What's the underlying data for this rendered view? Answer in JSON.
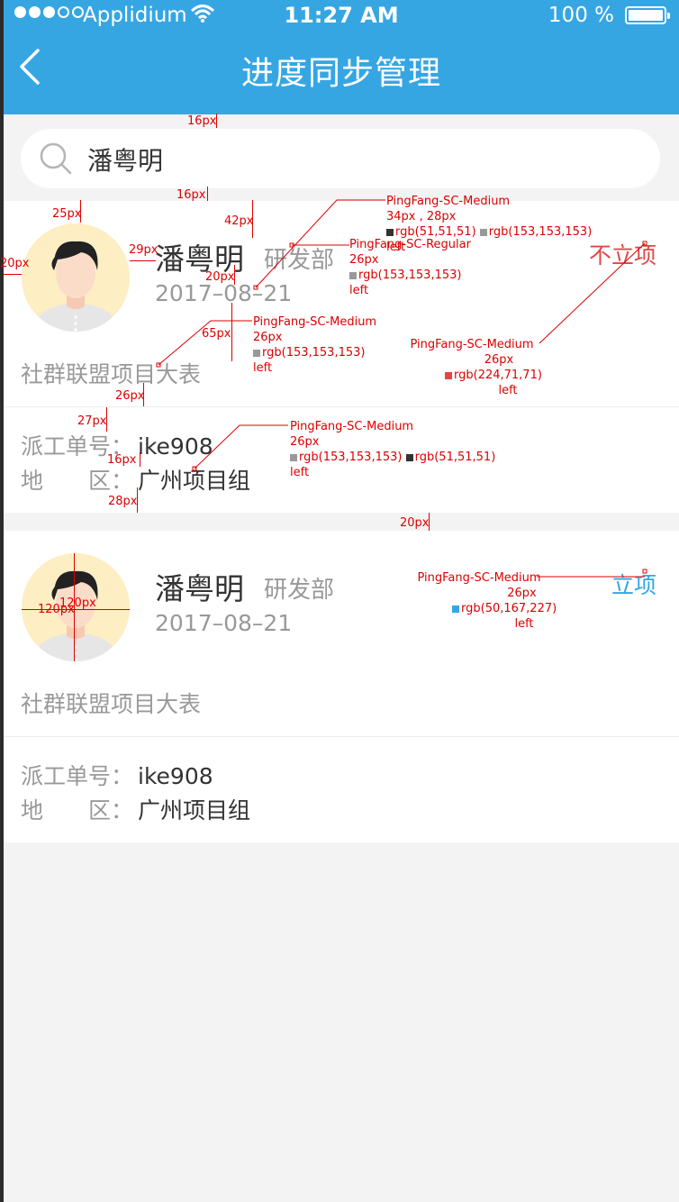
{
  "status_bar": {
    "carrier": "Applidium",
    "time": "11:27 AM",
    "battery": "100 %"
  },
  "header": {
    "title": "进度同步管理"
  },
  "search": {
    "value": "潘粤明"
  },
  "cards": [
    {
      "name": "潘粤明",
      "department": "研发部",
      "date": "2017–08–21",
      "status": "不立项",
      "status_color": "#e04747",
      "project": "社群联盟项目大表",
      "order_label": "派工单号：",
      "order_value": "ike908",
      "region_label": "地　　区：",
      "region_value": "广州项目组"
    },
    {
      "name": "潘粤明",
      "department": "研发部",
      "date": "2017–08–21",
      "status": "立项",
      "status_color": "#32a7e3",
      "project": "社群联盟项目大表",
      "order_label": "派工单号：",
      "order_value": "ike908",
      "region_label": "地　　区：",
      "region_value": "广州项目组"
    }
  ],
  "annotations": {
    "a1": "16px",
    "a2": "16px",
    "a3": "25px",
    "a4": "42px",
    "a5": "20px",
    "a6": "29px",
    "a7": "20px",
    "a8": "65px",
    "a9": "26px",
    "a10": "27px",
    "a11": "16px",
    "a12": "28px",
    "a13": "20px",
    "a14": "120px",
    "a15": "120px",
    "spec1": [
      "PingFang-SC-Medium",
      "34px , 28px",
      "rgb(51,51,51)",
      "rgb(153,153,153)",
      "left"
    ],
    "spec2": [
      "PingFang-SC-Regular",
      "26px",
      "rgb(153,153,153)",
      "left"
    ],
    "spec3": [
      "PingFang-SC-Medium",
      "26px",
      "rgb(153,153,153)",
      "left"
    ],
    "spec4": [
      "PingFang-SC-Medium",
      "26px",
      "rgb(224,71,71)",
      "left"
    ],
    "spec5": [
      "PingFang-SC-Medium",
      "26px",
      "rgb(153,153,153)",
      "rgb(51,51,51)",
      "left"
    ],
    "spec6": [
      "PingFang-SC-Medium",
      "26px",
      "rgb(50,167,227)",
      "left"
    ]
  }
}
